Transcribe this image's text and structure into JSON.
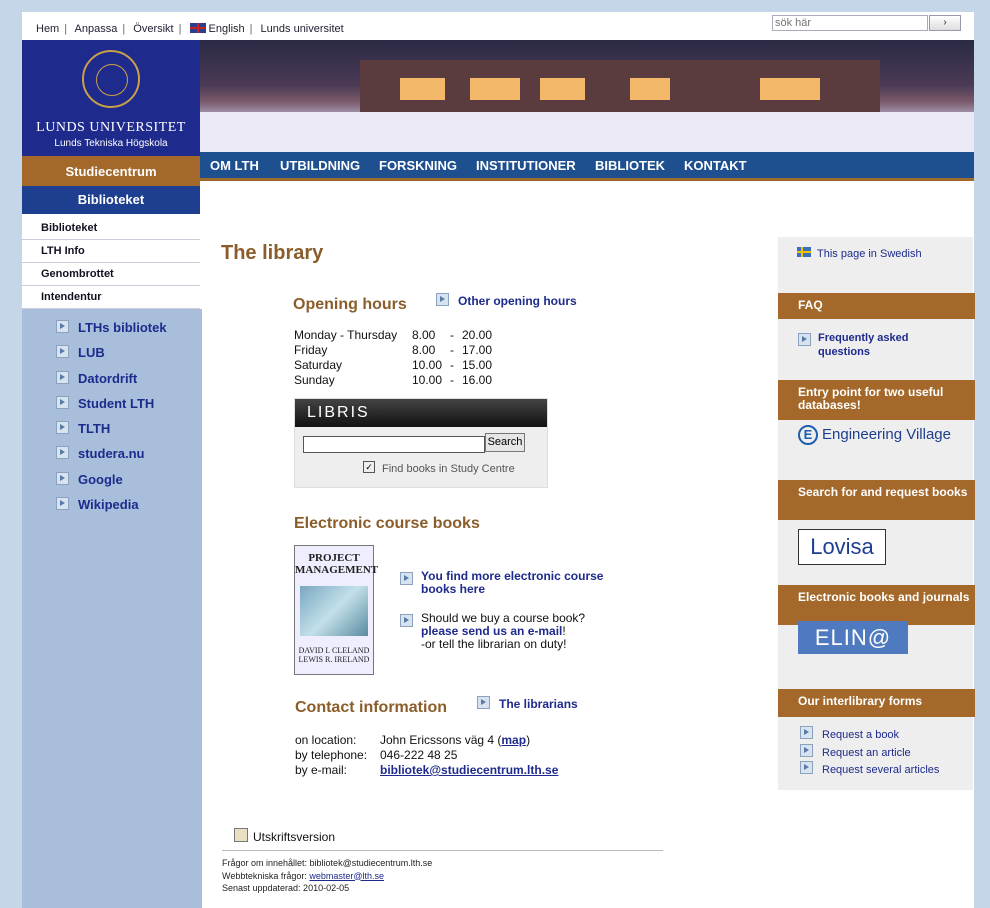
{
  "topbar": {
    "links": [
      "Hem",
      "Anpassa",
      "Översikt",
      "English",
      "Lunds universitet"
    ],
    "search_placeholder": "sök här",
    "search_button": "›"
  },
  "logo": {
    "line1": "LUNDS UNIVERSITET",
    "line2": "Lunds Tekniska Högskola"
  },
  "nav": [
    "OM LTH",
    "UTBILDNING",
    "FORSKNING",
    "INSTITUTIONER",
    "BIBLIOTEK",
    "KONTAKT"
  ],
  "sidebar": {
    "section": "Studiecentrum",
    "current": "Biblioteket",
    "sublinks": [
      "Biblioteket",
      "LTH Info",
      "Genombrottet",
      "Intendentur"
    ],
    "links": [
      "LTHs bibliotek",
      "LUB",
      "Datordrift",
      "Student LTH",
      "TLTH",
      "studera.nu",
      "Google",
      "Wikipedia"
    ]
  },
  "main": {
    "title": "The library",
    "opening_hours": {
      "heading": "Opening hours",
      "other_link": "Other opening hours",
      "rows": [
        {
          "day": "Monday - Thursday",
          "from": "8.00",
          "to": "20.00"
        },
        {
          "day": "Friday",
          "from": "8.00",
          "to": "17.00"
        },
        {
          "day": "Saturday",
          "from": "10.00",
          "to": "15.00"
        },
        {
          "day": "Sunday",
          "from": "10.00",
          "to": "16.00"
        }
      ]
    },
    "libris": {
      "logo": "LIBRIS",
      "button": "Search",
      "checkbox_label": "Find books in Study Centre"
    },
    "ecourse": {
      "heading": "Electronic course books",
      "book_title": "PROJECT MANAGEMENT",
      "book_authors": "DAVID I. CLELAND LEWIS R. IRELAND",
      "more_link": "You find more electronic course books here",
      "buy_text": "Should we buy a course book?",
      "buy_link": "please send us an e-mail",
      "buy_suffix": "!",
      "librarian_text": "-or tell the librarian on duty!"
    },
    "contact": {
      "heading": "Contact information",
      "librarians_link": "The librarians",
      "location_label": "on location:",
      "location": "John Ericssons väg 4 (",
      "map_link": "map",
      "location_end": ")",
      "phone_label": "by telephone:",
      "phone": "046-222 48 25",
      "email_label": "by e-mail:",
      "email": "bibliotek@studiecentrum.lth.se"
    },
    "print_link": "Utskriftsversion",
    "footer": {
      "content_q": "Frågor om innehållet: bibliotek@studiecentrum.lth.se",
      "tech_q_label": "Webbtekniska frågor: ",
      "tech_q_email": "webmaster@lth.se",
      "updated": "Senast uppdaterad: 2010-02-05"
    }
  },
  "right": {
    "swedish_link": "This page in Swedish",
    "faq_head": "FAQ",
    "faq_link": "Frequently asked questions",
    "db_head": "Entry point for two useful databases!",
    "ev_label": "Engineering Village",
    "lovisa_head": "Search for and request books",
    "lovisa_label": "Lovisa",
    "elin_head": "Electronic books and journals",
    "elin_label": "ELIN@",
    "ill_head": "Our interlibrary forms",
    "ill_links": [
      "Request a book",
      "Request an article",
      "Request several articles"
    ]
  }
}
